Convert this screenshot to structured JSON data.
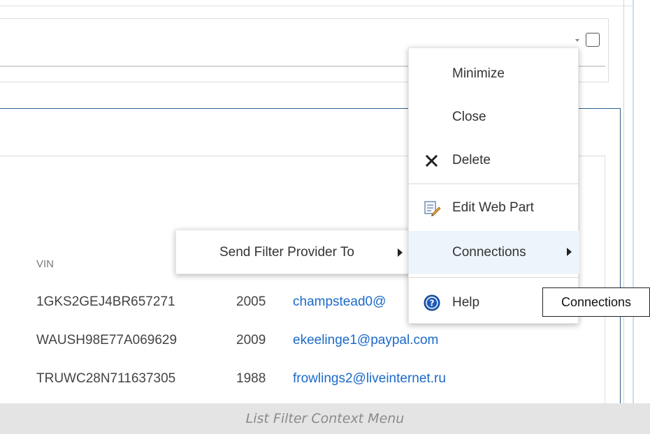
{
  "context_menu": {
    "items": [
      {
        "label": "Minimize",
        "icon": ""
      },
      {
        "label": "Close",
        "icon": ""
      },
      {
        "label": "Delete",
        "icon": "delete-x-icon"
      },
      {
        "label": "Edit Web Part",
        "icon": "edit-web-part-icon"
      },
      {
        "label": "Connections",
        "icon": "",
        "has_submenu": true,
        "highlighted": true
      },
      {
        "label": "Help",
        "icon": "help-icon"
      }
    ]
  },
  "submenu": {
    "label": "Send Filter Provider To"
  },
  "tooltip": {
    "text": "Connections"
  },
  "list": {
    "column_header": "VIN",
    "rows": [
      {
        "vin": "1GKS2GEJ4BR657271",
        "year": "2005",
        "email": "champstead0@"
      },
      {
        "vin": "WAUSH98E77A069629",
        "year": "2009",
        "email": "ekeelinge1@paypal.com"
      },
      {
        "vin": "TRUWC28N711637305",
        "year": "1988",
        "email": "frowlings2@liveinternet.ru"
      }
    ]
  },
  "caption": "List Filter Context Menu",
  "colors": {
    "accent": "#2a5d8f",
    "link": "#1b6ac9",
    "menu_highlight": "#edf5fc",
    "help_icon": "#1e5bb8"
  }
}
